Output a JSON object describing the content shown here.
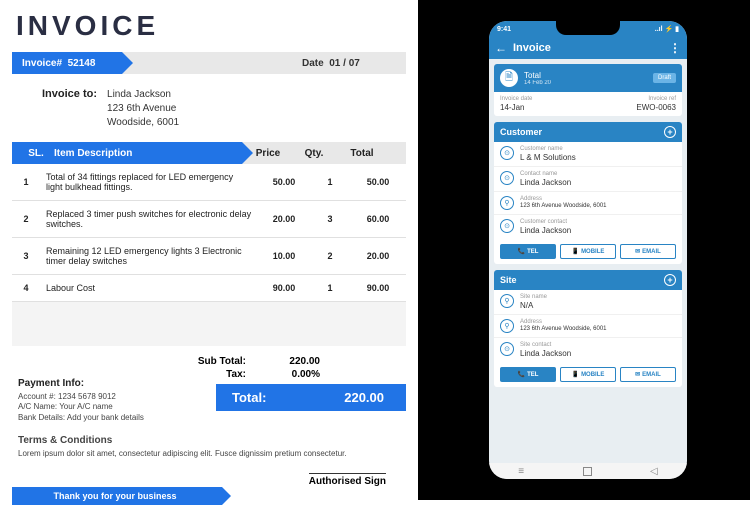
{
  "doc": {
    "title": "INVOICE",
    "invoice_label": "Invoice#",
    "invoice_number": "52148",
    "date_label": "Date",
    "date_value": "01 / 07",
    "to_label": "Invoice to:",
    "to_name": "Linda Jackson",
    "to_line1": "123 6th Avenue",
    "to_line2": "Woodside, 6001",
    "cols": {
      "sl": "SL.",
      "desc": "Item Description",
      "price": "Price",
      "qty": "Qty.",
      "total": "Total"
    },
    "rows": [
      {
        "sl": "1",
        "desc": "Total of 34 fittings replaced for LED emergency light bulkhead fittings.",
        "price": "50.00",
        "qty": "1",
        "total": "50.00"
      },
      {
        "sl": "2",
        "desc": "Replaced 3 timer push switches for electronic delay switches.",
        "price": "20.00",
        "qty": "3",
        "total": "60.00"
      },
      {
        "sl": "3",
        "desc": "Remaining 12 LED emergency lights 3 Electronic timer delay switches",
        "price": "10.00",
        "qty": "2",
        "total": "20.00"
      },
      {
        "sl": "4",
        "desc": "Labour Cost",
        "price": "90.00",
        "qty": "1",
        "total": "90.00"
      }
    ],
    "subtotal_label": "Sub Total:",
    "subtotal": "220.00",
    "tax_label": "Tax:",
    "tax": "0.00%",
    "total_label": "Total:",
    "total": "220.00",
    "pay_title": "Payment Info:",
    "pay_acct": "Account #:   1234 5678 9012",
    "pay_name": "A/C Name:   Your A/C name",
    "pay_bank": "Bank Details:   Add your bank details",
    "terms_title": "Terms & Conditions",
    "terms_text": "Lorem ipsum dolor sit amet, consectetur adipiscing elit. Fusce dignissim pretium consectetur.",
    "sign": "Authorised Sign",
    "thanks": "Thank you for your business"
  },
  "phone": {
    "time": "9:41",
    "status_icons": "..ıl ⚡ ▮",
    "app_title": "Invoice",
    "top_card": {
      "label": "Total",
      "amount": "14 Feb 20",
      "badge": "Draft"
    },
    "meta": {
      "date_lbl": "Invoice date",
      "date": "14-Jan",
      "ref_lbl": "Invoice ref",
      "ref": "EWO-0063"
    },
    "customer": {
      "title": "Customer",
      "name_lbl": "Customer name",
      "name": "L & M Solutions",
      "contact_lbl": "Contact name",
      "contact": "Linda Jackson",
      "addr_lbl": "Address",
      "addr": "123 6th Avenue Woodside, 6001",
      "cc_lbl": "Customer contact",
      "cc": "Linda Jackson"
    },
    "site": {
      "title": "Site",
      "name_lbl": "Site name",
      "name": "N/A",
      "addr_lbl": "Address",
      "addr": "123 6th Avenue Woodside, 6001",
      "contact_lbl": "Site contact",
      "contact": "Linda Jackson"
    },
    "btns": {
      "tel": "TEL",
      "mobile": "MOBILE",
      "email": "EMAIL"
    }
  }
}
